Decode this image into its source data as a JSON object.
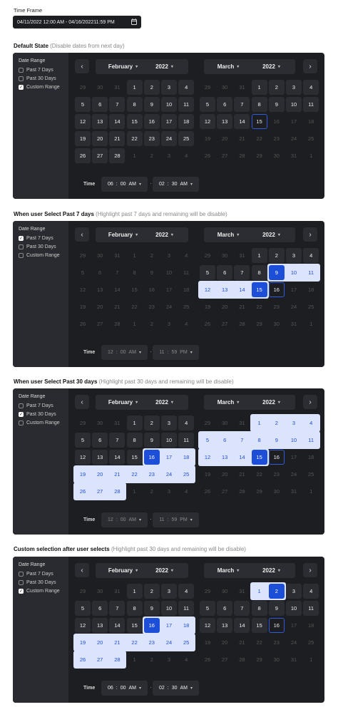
{
  "time_frame": {
    "label": "Time Frame",
    "value": "04/11/2022 12:00 AM -  04/16/202211:59 PM"
  },
  "sections": [
    {
      "title": "Default State",
      "subtitle": "(Disable dates from next day)",
      "options": [
        {
          "label": "Past 7 Days",
          "checked": false
        },
        {
          "label": "Past 30 Days",
          "checked": false
        },
        {
          "label": "Custom Range",
          "checked": true
        }
      ],
      "start_time": {
        "h": "06",
        "m": "00",
        "ap": "AM"
      },
      "end_time": {
        "h": "02",
        "m": "30",
        "ap": "AM"
      },
      "time_dim": false
    },
    {
      "title": "When user Select Past 7 days",
      "subtitle": "(Highlight past 7 days and remaining will be disable)",
      "options": [
        {
          "label": "Past 7 Days",
          "checked": true
        },
        {
          "label": "Past 30 Days",
          "checked": false
        },
        {
          "label": "Custom Range",
          "checked": false
        }
      ],
      "start_time": {
        "h": "12",
        "m": "00",
        "ap": "AM"
      },
      "end_time": {
        "h": "11",
        "m": "59",
        "ap": "PM"
      },
      "time_dim": true
    },
    {
      "title": "When user Select Past 30 days",
      "subtitle": "(Highlight past 30 days and remaining will be disable)",
      "options": [
        {
          "label": "Past 7 Days",
          "checked": false
        },
        {
          "label": "Past 30 Days",
          "checked": true
        },
        {
          "label": "Custom Range",
          "checked": false
        }
      ],
      "start_time": {
        "h": "12",
        "m": "00",
        "ap": "AM"
      },
      "end_time": {
        "h": "11",
        "m": "59",
        "ap": "PM"
      },
      "time_dim": true
    },
    {
      "title": "Custom selection after user selects",
      "subtitle": "(Highlight past 30 days and remaining will be disable)",
      "options": [
        {
          "label": "Past 7 Days",
          "checked": false
        },
        {
          "label": "Past 30 Days",
          "checked": false
        },
        {
          "label": "Custom Range",
          "checked": true
        }
      ],
      "start_time": {
        "h": "06",
        "m": "00",
        "ap": "AM"
      },
      "end_time": {
        "h": "02",
        "m": "30",
        "ap": "AM"
      },
      "time_dim": false
    }
  ],
  "date_range_label": "Date Range",
  "time_label": "Time",
  "months": {
    "left": "February",
    "right": "March",
    "year": "2022"
  },
  "feb_days": [
    [
      "29",
      "30",
      "31",
      "1",
      "2",
      "3",
      "4"
    ],
    [
      "5",
      "6",
      "7",
      "8",
      "9",
      "10",
      "11"
    ],
    [
      "12",
      "13",
      "14",
      "15",
      "16",
      "17",
      "18"
    ],
    [
      "19",
      "20",
      "21",
      "22",
      "23",
      "24",
      "25"
    ],
    [
      "26",
      "27",
      "28",
      "1",
      "2",
      "3",
      "4"
    ]
  ],
  "mar_days": [
    [
      "29",
      "30",
      "31",
      "1",
      "2",
      "3",
      "4"
    ],
    [
      "5",
      "6",
      "7",
      "8",
      "9",
      "10",
      "11"
    ],
    [
      "12",
      "13",
      "14",
      "15",
      "16",
      "17",
      "18"
    ],
    [
      "19",
      "20",
      "21",
      "22",
      "23",
      "24",
      "25"
    ],
    [
      "26",
      "27",
      "28",
      "29",
      "30",
      "31",
      "1"
    ]
  ]
}
